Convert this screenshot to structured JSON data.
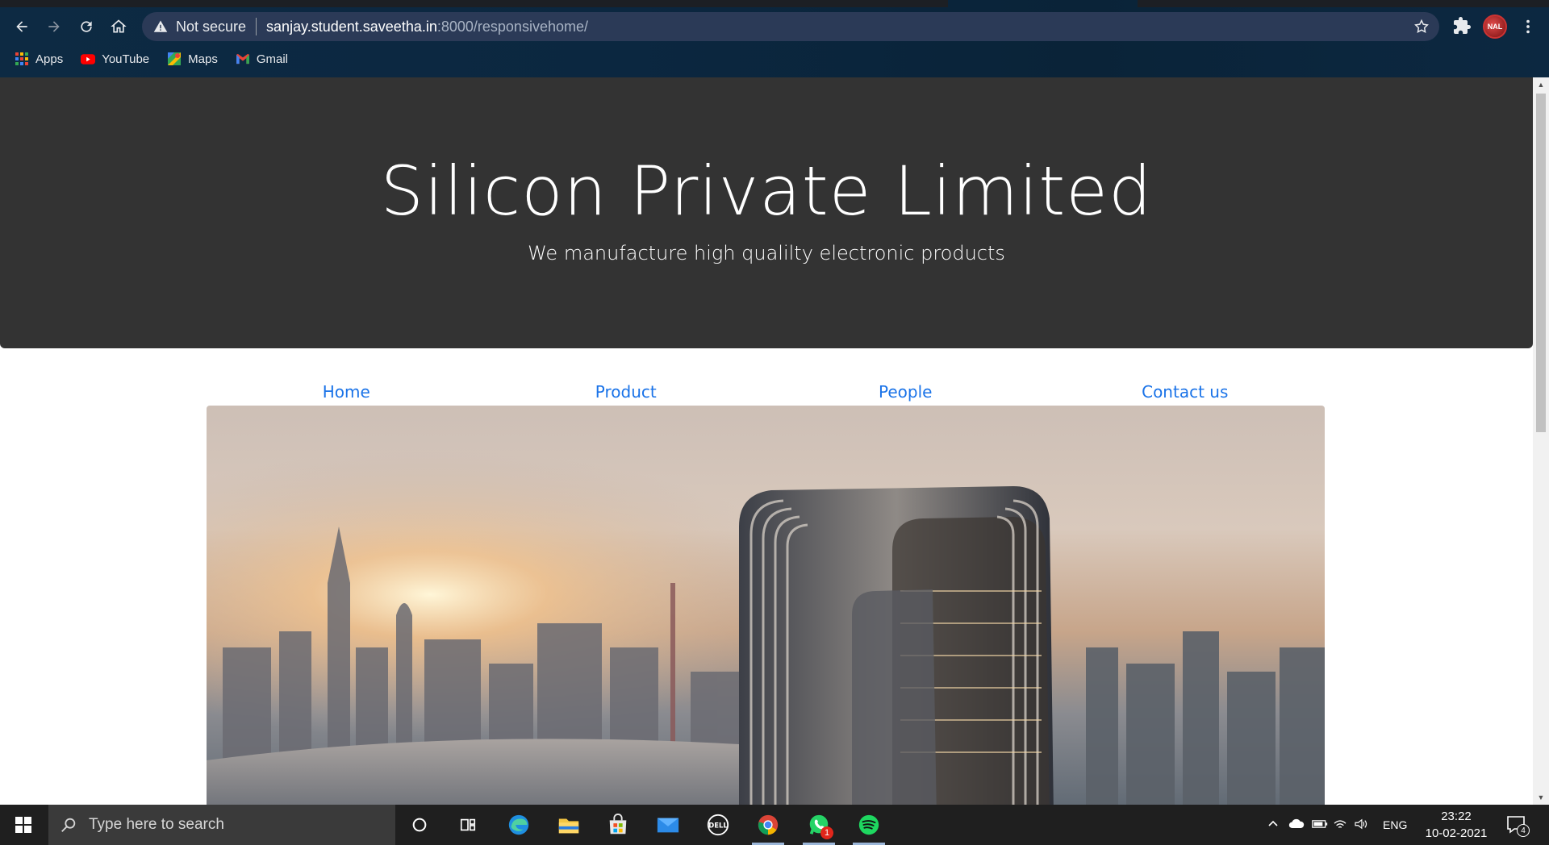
{
  "browser": {
    "security_label": "Not secure",
    "url_host": "sanjay.student.saveetha.in",
    "url_path": ":8000/responsivehome/",
    "profile_badge": "NAL",
    "bookmarks": [
      {
        "label": "Apps",
        "icon": "apps-grid-icon"
      },
      {
        "label": "YouTube",
        "icon": "youtube-icon"
      },
      {
        "label": "Maps",
        "icon": "maps-icon"
      },
      {
        "label": "Gmail",
        "icon": "gmail-icon"
      }
    ]
  },
  "page": {
    "title": "Silicon Private Limited",
    "subtitle": "We manufacture high qualilty electronic products",
    "nav": [
      "Home",
      "Product",
      "People",
      "Contact us"
    ],
    "link_color": "#1a73e8",
    "jumbotron_color": "#333333"
  },
  "taskbar": {
    "search_placeholder": "Type here to search",
    "language": "ENG",
    "time": "23:22",
    "date": "10-02-2021",
    "whatsapp_badge": "1",
    "notification_count": "4"
  }
}
